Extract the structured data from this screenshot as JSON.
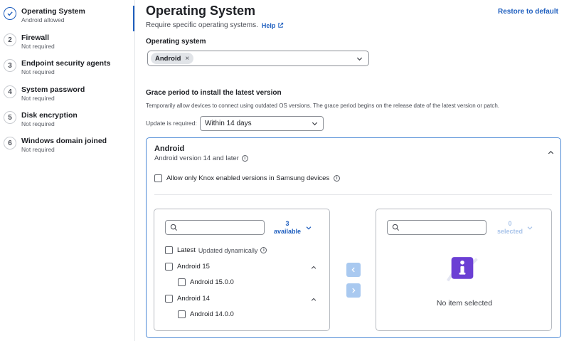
{
  "sidebar": {
    "items": [
      {
        "number": "",
        "title": "Operating System",
        "subtitle": "Android allowed",
        "status": "complete"
      },
      {
        "number": "2",
        "title": "Firewall",
        "subtitle": "Not required"
      },
      {
        "number": "3",
        "title": "Endpoint security agents",
        "subtitle": "Not required"
      },
      {
        "number": "4",
        "title": "System password",
        "subtitle": "Not required"
      },
      {
        "number": "5",
        "title": "Disk encryption",
        "subtitle": "Not required"
      },
      {
        "number": "6",
        "title": "Windows domain joined",
        "subtitle": "Not required"
      }
    ]
  },
  "header": {
    "title": "Operating System",
    "subtitle": "Require specific operating systems.",
    "help_label": "Help",
    "restore_label": "Restore to default"
  },
  "os_section": {
    "label": "Operating system",
    "selected_chip": "Android",
    "chip_remove": "×"
  },
  "grace": {
    "label": "Grace period to install the latest version",
    "description": "Temporarily allow devices to connect using outdated OS versions. The grace period begins on the release date of the latest version or patch.",
    "update_label": "Update is required:",
    "update_value": "Within 14 days"
  },
  "android_card": {
    "title": "Android",
    "subtitle": "Android version 14 and later",
    "knox_label": "Allow only Knox enabled versions in Samsung devices",
    "available": {
      "count": "3",
      "label": "available"
    },
    "selected": {
      "count": "0",
      "label": "selected"
    },
    "list": [
      {
        "label": "Latest",
        "sub": "Updated dynamically"
      },
      {
        "label": "Android 15",
        "children": [
          {
            "label": "Android 15.0.0"
          }
        ]
      },
      {
        "label": "Android 14",
        "children": [
          {
            "label": "Android 14.0.0"
          }
        ]
      }
    ],
    "empty_text": "No item selected",
    "empty_icon_letter": "i"
  },
  "colors": {
    "accent": "#1f5fbf",
    "card_border": "#4d8ad6",
    "transfer_button": "#a9c9f0",
    "empty_icon": "#6b3fd4"
  }
}
